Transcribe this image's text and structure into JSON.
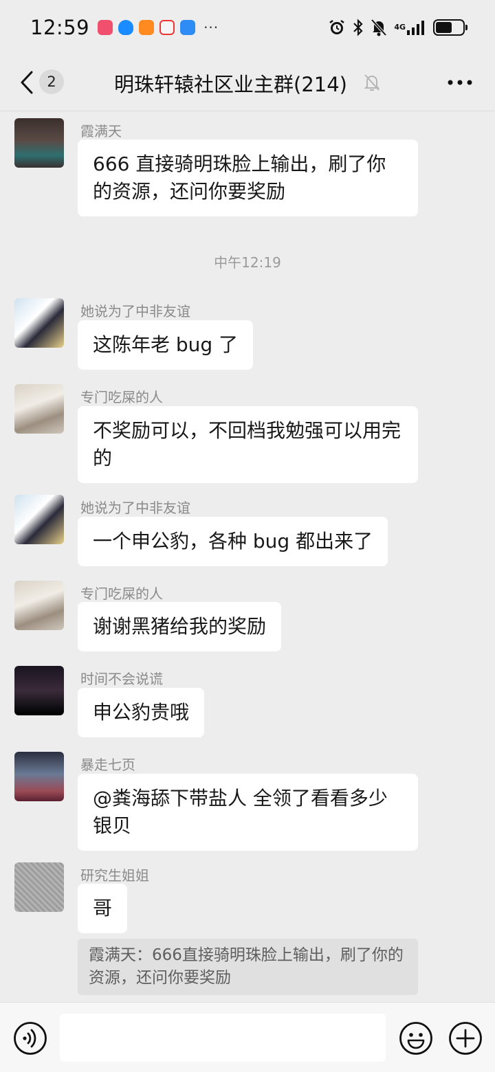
{
  "status_bar": {
    "time": "12:59",
    "overflow": "···",
    "network": "4G",
    "battery_level": 0.6,
    "icons": [
      "notification-app-icon",
      "shield-app-icon",
      "video-app-icon",
      "calendar-app-icon",
      "weather-app-icon",
      "alarm-icon",
      "bluetooth-icon",
      "mute-bell-icon",
      "signal-icon",
      "battery-icon"
    ]
  },
  "nav": {
    "unread_count": "2",
    "title": "明珠轩辕社区业主群(214)"
  },
  "messages": [
    {
      "sender": "霞满天",
      "text": "666 直接骑明珠脸上输出，刷了你的资源，还问你要奖励"
    },
    {
      "sender": "她说为了中非友谊",
      "text": "这陈年老 bug 了"
    },
    {
      "sender": "专门吃屎的人",
      "text": "不奖励可以，不回档我勉强可以用完的"
    },
    {
      "sender": "她说为了中非友谊",
      "text": "一个申公豹，各种 bug 都出来了"
    },
    {
      "sender": "专门吃屎的人",
      "text": "谢谢黑猪给我的奖励"
    },
    {
      "sender": "时间不会说谎",
      "text": "申公豹贵哦"
    },
    {
      "sender": "暴走七页",
      "text": "@粪海舔下带盐人  全领了看看多少银贝"
    },
    {
      "sender": "研究生姐姐",
      "text": "哥"
    }
  ],
  "time_separator": "中午12:19",
  "quote": "霞满天：666直接骑明珠脸上输出，刷了你的资源，还问你要奖励",
  "input": {
    "value": "",
    "placeholder": ""
  }
}
